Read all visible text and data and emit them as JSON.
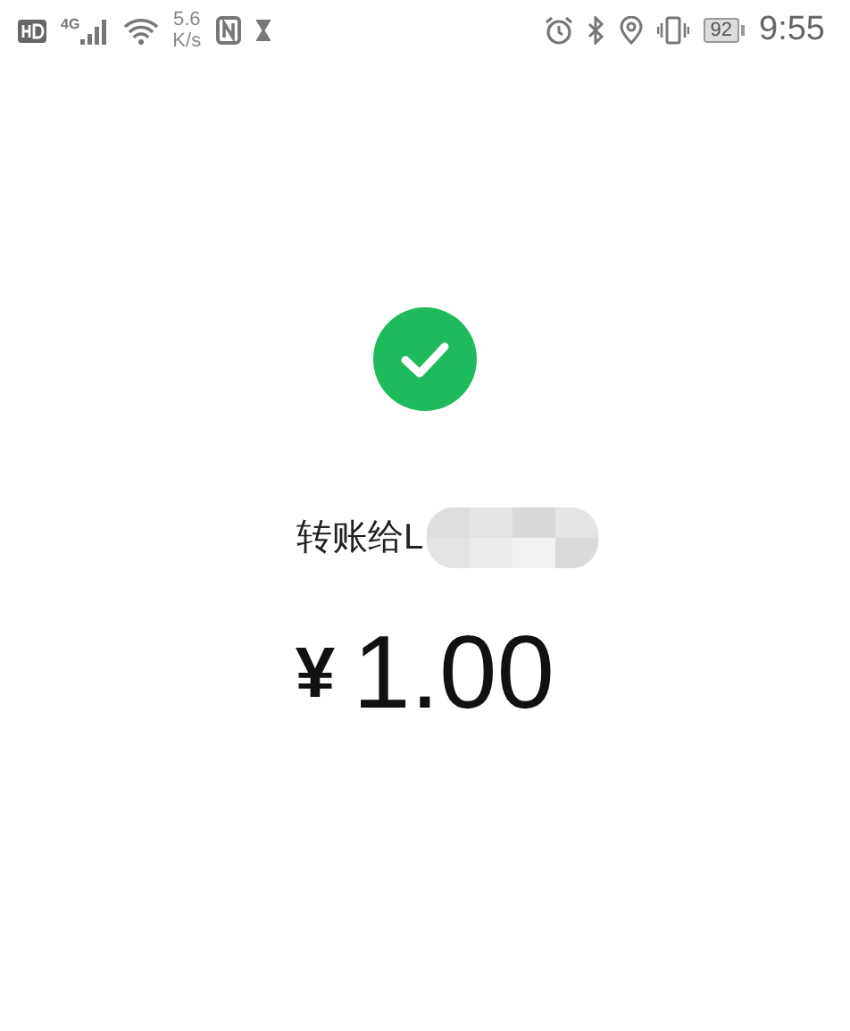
{
  "status_bar": {
    "network_type": "4G",
    "speed_value": "5.6",
    "speed_unit": "K/s",
    "battery": "92",
    "time": "9:55"
  },
  "result": {
    "recipient_label": "转账给L",
    "currency": "¥",
    "amount": "1.00"
  }
}
